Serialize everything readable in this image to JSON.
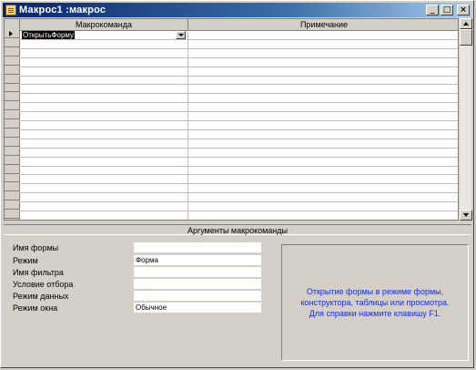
{
  "window": {
    "title": "Макрос1 :макрос",
    "buttons": {
      "minimize": "_",
      "maximize": "□",
      "close": "×"
    }
  },
  "grid": {
    "columns": [
      {
        "label": "Макрокоманда"
      },
      {
        "label": "Примечание"
      }
    ],
    "rows": [
      {
        "action": "ОткрытьФорму",
        "note": "",
        "current": true
      }
    ]
  },
  "arguments": {
    "title": "Аргументы макрокоманды",
    "fields": [
      {
        "label": "Имя формы",
        "value": ""
      },
      {
        "label": "Режим",
        "value": "Форма"
      },
      {
        "label": "Имя фильтра",
        "value": ""
      },
      {
        "label": "Условие отбора",
        "value": ""
      },
      {
        "label": "Режим данных",
        "value": ""
      },
      {
        "label": "Режим окна",
        "value": "Обычное"
      }
    ],
    "help": "Открытие формы в режиме формы,\nконструктора, таблицы или просмотра.\nДля справки нажмите клавишу F1."
  }
}
